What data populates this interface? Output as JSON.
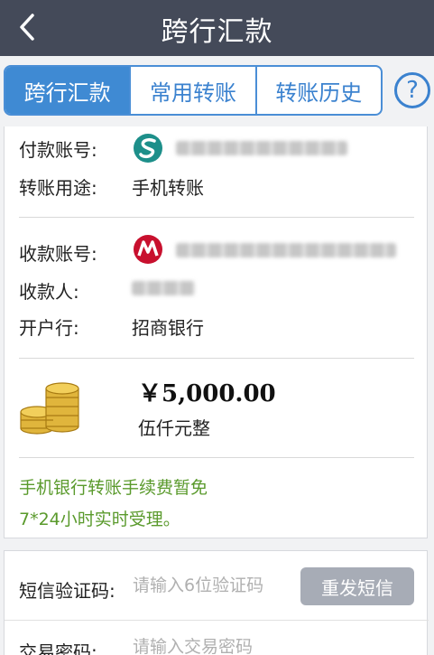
{
  "header": {
    "title": "跨行汇款",
    "back_icon": "chevron-left-icon"
  },
  "tabs": [
    {
      "label": "跨行汇款",
      "active": true
    },
    {
      "label": "常用转账",
      "active": false
    },
    {
      "label": "转账历史",
      "active": false
    }
  ],
  "help": {
    "label": "?"
  },
  "payer": {
    "account_label": "付款账号:",
    "bank_icon": "spdb-bank-logo",
    "purpose_label": "转账用途:",
    "purpose_value": "手机转账"
  },
  "payee": {
    "account_label": "收款账号:",
    "bank_icon": "cmb-bank-logo",
    "name_label": "收款人:",
    "bank_label": "开户行:",
    "bank_value": "招商银行"
  },
  "amount": {
    "value": "￥5,000.00",
    "words": "伍仟元整",
    "icon": "gold-coins-icon"
  },
  "notes": {
    "line1": "手机银行转账手续费暂免",
    "line2": "7*24小时实时受理。"
  },
  "verification": {
    "sms_label": "短信验证码:",
    "sms_placeholder": "请输入6位验证码",
    "resend_label": "重发短信",
    "password_label": "交易密码:",
    "password_placeholder": "请输入交易密码"
  },
  "colors": {
    "topbar": "#444a59",
    "accent": "#3f8ad3",
    "note_green": "#5a9a2c",
    "resend_gray": "#a7acb6"
  }
}
